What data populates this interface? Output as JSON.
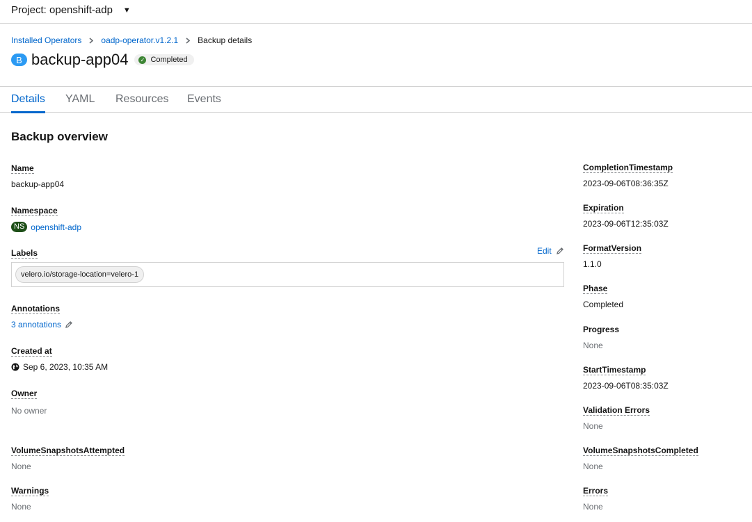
{
  "project": {
    "label": "Project: openshift-adp"
  },
  "breadcrumb": {
    "items": [
      "Installed Operators",
      "oadp-operator.v1.2.1"
    ],
    "current": "Backup details"
  },
  "resource": {
    "badge": "B",
    "name": "backup-app04",
    "status": "Completed"
  },
  "tabs": [
    "Details",
    "YAML",
    "Resources",
    "Events"
  ],
  "section_title": "Backup overview",
  "left": {
    "name": {
      "label": "Name",
      "value": "backup-app04"
    },
    "namespace": {
      "label": "Namespace",
      "badge": "NS",
      "value": "openshift-adp"
    },
    "labels": {
      "label": "Labels",
      "edit": "Edit",
      "chips": [
        "velero.io/storage-location=velero-1"
      ]
    },
    "annotations": {
      "label": "Annotations",
      "value": "3 annotations"
    },
    "created_at": {
      "label": "Created at",
      "value": "Sep 6, 2023, 10:35 AM"
    },
    "owner": {
      "label": "Owner",
      "value": "No owner"
    },
    "volume_snapshots_attempted": {
      "label": "VolumeSnapshotsAttempted",
      "value": "None"
    },
    "warnings": {
      "label": "Warnings",
      "value": "None"
    }
  },
  "right": {
    "completion_timestamp": {
      "label": "CompletionTimestamp",
      "value": "2023-09-06T08:36:35Z"
    },
    "expiration": {
      "label": "Expiration",
      "value": "2023-09-06T12:35:03Z"
    },
    "format_version": {
      "label": "FormatVersion",
      "value": "1.1.0"
    },
    "phase": {
      "label": "Phase",
      "value": "Completed"
    },
    "progress": {
      "label": "Progress",
      "value": "None"
    },
    "start_timestamp": {
      "label": "StartTimestamp",
      "value": "2023-09-06T08:35:03Z"
    },
    "validation_errors": {
      "label": "Validation Errors",
      "value": "None"
    },
    "volume_snapshots_completed": {
      "label": "VolumeSnapshotsCompleted",
      "value": "None"
    },
    "errors": {
      "label": "Errors",
      "value": "None"
    }
  },
  "colors": {
    "link": "#0066cc",
    "status_success": "#3e8635",
    "resource_badge": "#2b9af3",
    "namespace_badge": "#1e4f18"
  },
  "icons": {
    "project_caret": "caret-down-icon",
    "breadcrumb_separator": "chevron-right-icon",
    "status": "check-circle-icon",
    "edit": "pencil-icon",
    "created": "globe-icon"
  }
}
